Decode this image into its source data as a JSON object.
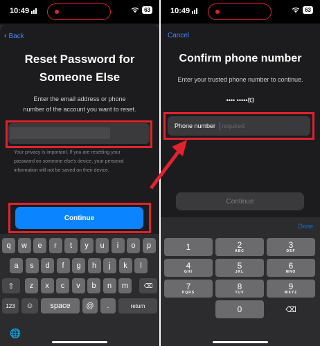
{
  "left": {
    "status": {
      "time": "10:49",
      "battery": "63"
    },
    "back_label": "Back",
    "title_line1": "Reset Password for",
    "title_line2": "Someone Else",
    "instructions_line1": "Enter the email address or phone",
    "instructions_line2": "number of the account you want to reset.",
    "privacy_line1": "Your privacy is important. If you are resetting your",
    "privacy_line2": "password on someone else's device, your personal",
    "privacy_line3": "information will not be saved on their device.",
    "continue_label": "Continue",
    "keyboard": {
      "row1": [
        "q",
        "w",
        "e",
        "r",
        "t",
        "y",
        "u",
        "i",
        "o",
        "p"
      ],
      "row2": [
        "a",
        "s",
        "d",
        "f",
        "g",
        "h",
        "j",
        "k",
        "l"
      ],
      "row3": [
        "z",
        "x",
        "c",
        "v",
        "b",
        "n",
        "m"
      ],
      "numbers_key": "123",
      "space": "space",
      "at": "@",
      "dot": ".",
      "return": "return"
    }
  },
  "right": {
    "status": {
      "time": "10:49",
      "battery": "63"
    },
    "cancel_label": "Cancel",
    "title": "Confirm phone number",
    "instructions": "Enter your trusted phone number to continue.",
    "masked_number": "•••• •••••83",
    "field_label": "Phone number",
    "field_placeholder": "required",
    "continue_label": "Continue",
    "done_label": "Done",
    "numpad": [
      {
        "n": "1",
        "l": ""
      },
      {
        "n": "2",
        "l": "ABC"
      },
      {
        "n": "3",
        "l": "DEF"
      },
      {
        "n": "4",
        "l": "GHI"
      },
      {
        "n": "5",
        "l": "JKL"
      },
      {
        "n": "6",
        "l": "MNO"
      },
      {
        "n": "7",
        "l": "PQRS"
      },
      {
        "n": "8",
        "l": "TUV"
      },
      {
        "n": "9",
        "l": "WXYZ"
      },
      {
        "n": "0",
        "l": ""
      }
    ]
  },
  "colors": {
    "accent": "#0a84ff",
    "annotation_red": "#e0232d",
    "background": "#1c1c1e"
  }
}
